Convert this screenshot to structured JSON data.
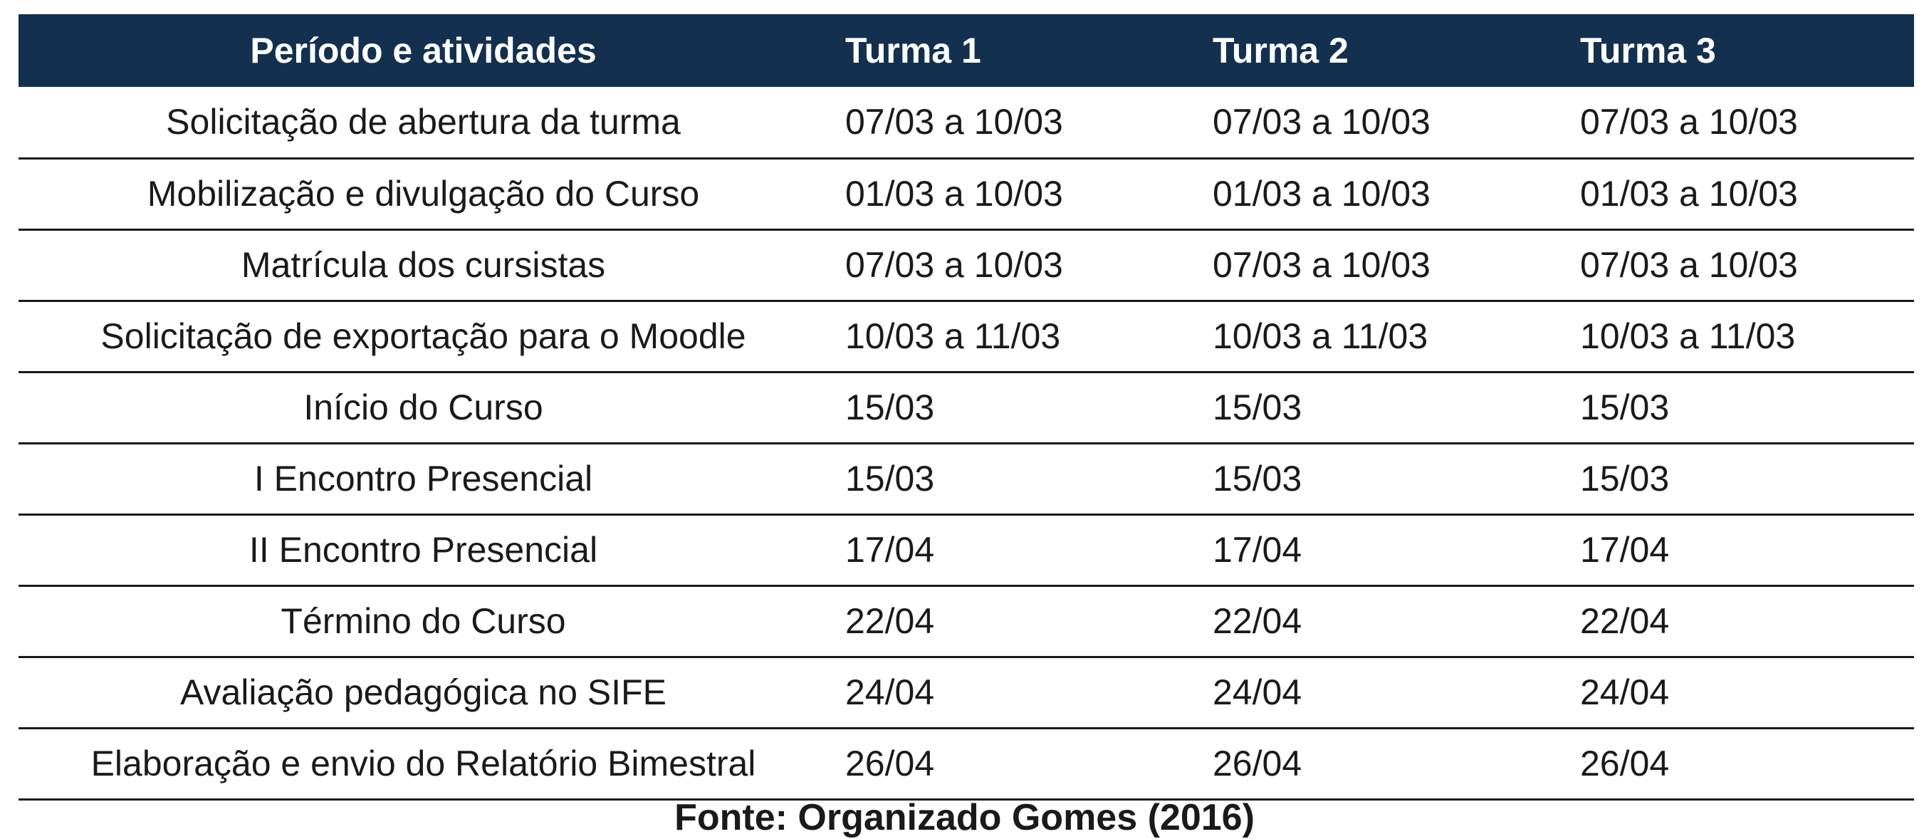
{
  "table": {
    "headers": [
      "Período e atividades",
      "Turma 1",
      "Turma 2",
      "Turma 3"
    ],
    "rows": [
      [
        "Solicitação de abertura da turma",
        "07/03 a 10/03",
        "07/03 a 10/03",
        "07/03 a 10/03"
      ],
      [
        "Mobilização e divulgação do Curso",
        "01/03 a 10/03",
        "01/03 a 10/03",
        "01/03 a 10/03"
      ],
      [
        "Matrícula dos cursistas",
        "07/03 a 10/03",
        "07/03 a 10/03",
        "07/03 a 10/03"
      ],
      [
        "Solicitação de exportação para o Moodle",
        "10/03 a 11/03",
        "10/03 a 11/03",
        "10/03 a 11/03"
      ],
      [
        "Início do Curso",
        "15/03",
        "15/03",
        "15/03"
      ],
      [
        "I Encontro Presencial",
        "15/03",
        "15/03",
        "15/03"
      ],
      [
        "II Encontro Presencial",
        "17/04",
        "17/04",
        "17/04"
      ],
      [
        "Término do Curso",
        "22/04",
        "22/04",
        "22/04"
      ],
      [
        "Avaliação pedagógica no SIFE",
        "24/04",
        "24/04",
        "24/04"
      ],
      [
        "Elaboração e envio do Relatório Bimestral",
        "26/04",
        "26/04",
        "26/04"
      ]
    ]
  },
  "caption": "Fonte: Organizado Gomes (2016)",
  "colors": {
    "header_background": "#13304f",
    "header_text": "#ffffff",
    "body_text": "#1a1a1a",
    "row_border": "#1a1a1a"
  }
}
